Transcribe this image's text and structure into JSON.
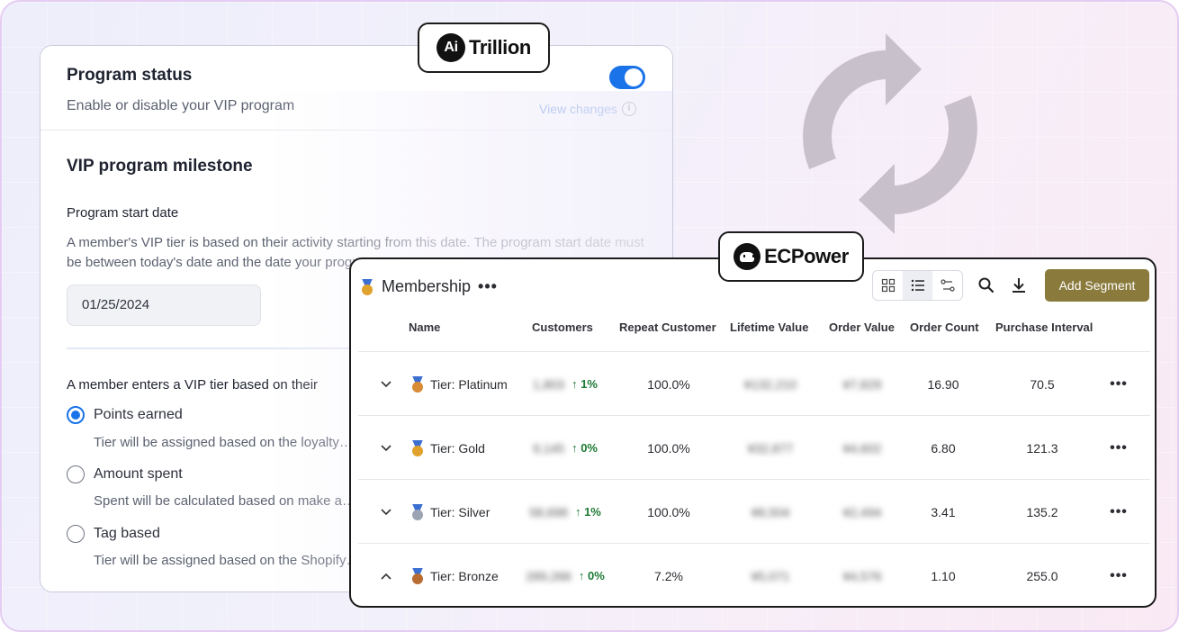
{
  "aitrillion": {
    "brand": "Trillion",
    "brand_mark": "Ai",
    "status": {
      "title": "Program status",
      "description": "Enable or disable your VIP program",
      "toggle_on": true,
      "view_changes": "View changes"
    },
    "milestone": {
      "title": "VIP program milestone",
      "start_date_label": "Program start date",
      "start_date_desc": "A member's VIP tier is based on their activity starting from this date. The program start date must be between today's date and the date your program…",
      "start_date_value": "01/25/2024",
      "tier_basis_label": "A member enters a VIP tier based on their",
      "options": [
        {
          "label": "Points earned",
          "desc": "Tier will be assigned based on the loyalty…",
          "checked": true
        },
        {
          "label": "Amount spent",
          "desc": "Spent will be calculated based on make a…",
          "checked": false
        },
        {
          "label": "Tag based",
          "desc": "Tier will be assigned based on the Shopify…",
          "checked": false
        }
      ]
    }
  },
  "ecpower": {
    "brand": "ECPower",
    "title": "Membership",
    "add_segment": "Add Segment",
    "columns": [
      "Name",
      "Customers",
      "Repeat Customer",
      "Lifetime Value",
      "Order Value",
      "Order Count",
      "Purchase Interval"
    ],
    "rows": [
      {
        "name": "Tier: Platinum",
        "customers": "1,803",
        "change": "1%",
        "repeat": "100.0%",
        "lifetime": "¥132,210",
        "order_value": "¥7,829",
        "order_count": "16.90",
        "interval": "70.5",
        "expanded": false,
        "medal_color": "#d88a34"
      },
      {
        "name": "Tier: Gold",
        "customers": "9,145",
        "change": "0%",
        "repeat": "100.0%",
        "lifetime": "¥32,877",
        "order_value": "¥4,602",
        "order_count": "6.80",
        "interval": "121.3",
        "expanded": false,
        "medal_color": "#e0a22c"
      },
      {
        "name": "Tier: Silver",
        "customers": "58,698",
        "change": "1%",
        "repeat": "100.0%",
        "lifetime": "¥8,504",
        "order_value": "¥2,494",
        "order_count": "3.41",
        "interval": "135.2",
        "expanded": false,
        "medal_color": "#9aa4b2"
      },
      {
        "name": "Tier: Bronze",
        "customers": "289,266",
        "change": "0%",
        "repeat": "7.2%",
        "lifetime": "¥5,071",
        "order_value": "¥4,576",
        "order_count": "1.10",
        "interval": "255.0",
        "expanded": true,
        "medal_color": "#b86c32"
      }
    ]
  },
  "colors": {
    "accent_blue": "#1a73e8",
    "add_segment_bg": "#8a7a3c",
    "positive_green": "#1e7a34"
  }
}
